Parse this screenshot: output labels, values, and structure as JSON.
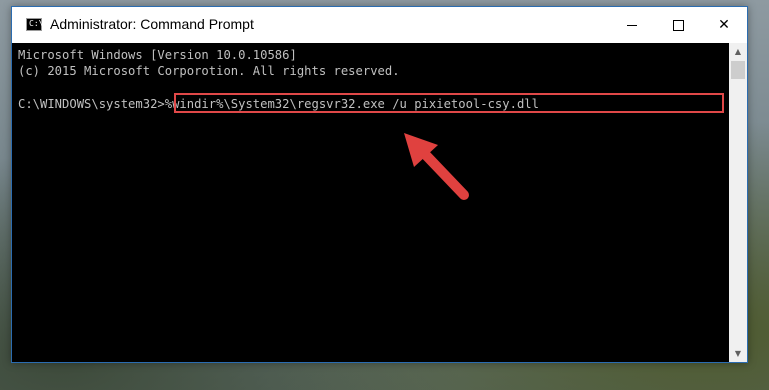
{
  "window": {
    "title": "Administrator: Command Prompt",
    "icon": "cmd-icon",
    "controls": {
      "minimize": "minimize-icon",
      "maximize": "maximize-icon",
      "close": "✕"
    }
  },
  "console": {
    "line1": "Microsoft Windows [Version 10.0.10586]",
    "line2": "(c) 2015 Microsoft Corporotion. All rights reserved.",
    "prompt": "C:\\WINDOWS\\system32>",
    "command": "%windir%\\System32\\regsvr32.exe /u pixietool-csy.dll",
    "highlight_color": "#e04848",
    "text_color": "#c0c0c0",
    "background": "#000000"
  },
  "scrollbar": {
    "up_glyph": "▲",
    "down_glyph": "▼"
  }
}
